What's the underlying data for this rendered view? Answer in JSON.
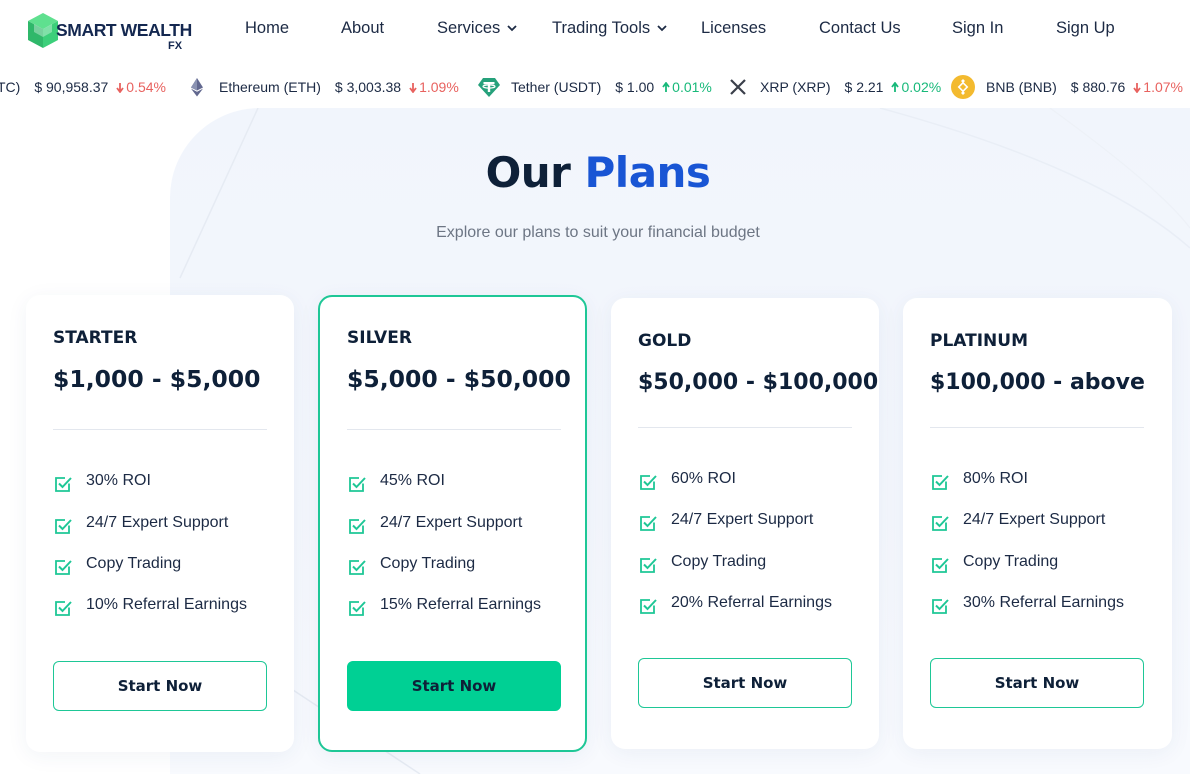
{
  "brand": {
    "name": "SMART WEALTH",
    "sub": "FX",
    "green": "#3ccf7a",
    "navy": "#142850"
  },
  "nav": {
    "items": [
      {
        "label": "Home",
        "dropdown": false
      },
      {
        "label": "About",
        "dropdown": false
      },
      {
        "label": "Services",
        "dropdown": true
      },
      {
        "label": "Trading Tools",
        "dropdown": true
      },
      {
        "label": "Licenses",
        "dropdown": false
      },
      {
        "label": "Contact Us",
        "dropdown": false
      },
      {
        "label": "Sign In",
        "dropdown": false
      },
      {
        "label": "Sign Up",
        "dropdown": false
      }
    ]
  },
  "ticker": [
    {
      "name": "TC)",
      "price": "$ 90,958.37",
      "change": "0.54%",
      "direction": "down",
      "icon": "bitcoin-icon"
    },
    {
      "name": "Ethereum (ETH)",
      "price": "$ 3,003.38",
      "change": "1.09%",
      "direction": "down",
      "icon": "ethereum-icon"
    },
    {
      "name": "Tether (USDT)",
      "price": "$ 1.00",
      "change": "0.01%",
      "direction": "up",
      "icon": "tether-icon"
    },
    {
      "name": "XRP (XRP)",
      "price": "$ 2.21",
      "change": "0.02%",
      "direction": "up",
      "icon": "xrp-icon"
    },
    {
      "name": "BNB (BNB)",
      "price": "$ 880.76",
      "change": "1.07%",
      "direction": "down",
      "icon": "bnb-icon"
    }
  ],
  "section": {
    "title_main": "Our",
    "title_accent": "Plans",
    "subtitle": "Explore our plans to suit your financial budget"
  },
  "plans": [
    {
      "name": "STARTER",
      "range": "$1,000 - $5,000",
      "features": [
        "30% ROI",
        "24/7 Expert Support",
        "Copy Trading",
        "10% Referral Earnings"
      ],
      "button": "Start Now",
      "featured": false
    },
    {
      "name": "SILVER",
      "range": "$5,000 - $50,000",
      "features": [
        "45% ROI",
        "24/7 Expert Support",
        "Copy Trading",
        "15% Referral Earnings"
      ],
      "button": "Start Now",
      "featured": true
    },
    {
      "name": "GOLD",
      "range": "$50,000 - $100,000",
      "features": [
        "60% ROI",
        "24/7 Expert Support",
        "Copy Trading",
        "20% Referral Earnings"
      ],
      "button": "Start Now",
      "featured": false
    },
    {
      "name": "PLATINUM",
      "range": "$100,000 - above",
      "features": [
        "80% ROI",
        "24/7 Expert Support",
        "Copy Trading",
        "30% Referral Earnings"
      ],
      "button": "Start Now",
      "featured": false
    }
  ],
  "colors": {
    "accent_blue": "#1955d4",
    "accent_green": "#00d094",
    "down_red": "#e8625f",
    "up_green": "#18b97a"
  }
}
